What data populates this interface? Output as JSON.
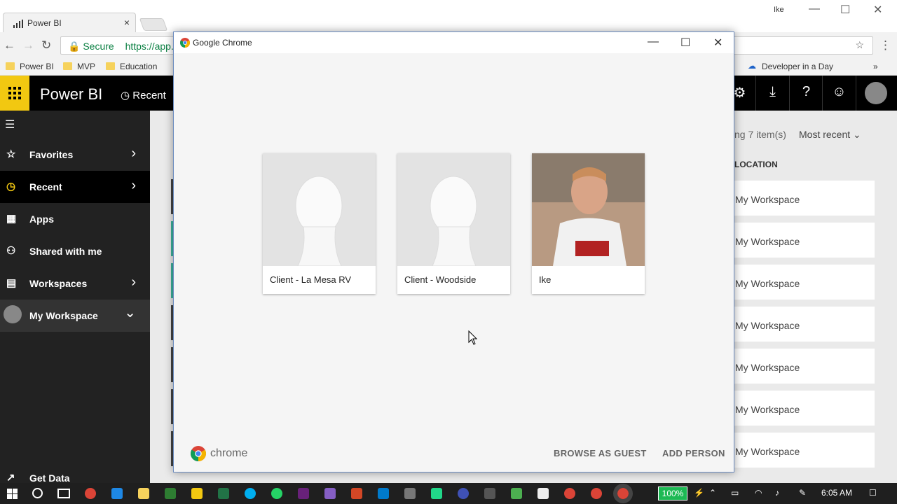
{
  "browser": {
    "tab_title": "Power BI",
    "tab_close": "×",
    "window_user": "Ike",
    "secure_label": "Secure",
    "url": "https://app.p",
    "bookmarks": [
      "Power BI",
      "MVP",
      "Education"
    ],
    "bookmark_right": "Developer in a Day",
    "more": "»"
  },
  "powerbi": {
    "app_name": "Power BI",
    "recent_label": "Recent",
    "nav": [
      {
        "label": "Favorites",
        "arrow": "›"
      },
      {
        "label": "Recent",
        "arrow": "›"
      },
      {
        "label": "Apps",
        "arrow": ""
      },
      {
        "label": "Shared with me",
        "arrow": ""
      },
      {
        "label": "Workspaces",
        "arrow": "›"
      },
      {
        "label": "My Workspace",
        "arrow": "⌄"
      }
    ],
    "get_data": "Get Data",
    "items_count": "ng 7 item(s)",
    "sort": "Most recent",
    "location_header": "LOCATION",
    "locations": [
      "My Workspace",
      "My Workspace",
      "My Workspace",
      "My Workspace",
      "My Workspace",
      "My Workspace",
      "My Workspace"
    ]
  },
  "dialog": {
    "title": "Google Chrome",
    "profiles": [
      {
        "name": "Client - La Mesa RV"
      },
      {
        "name": "Client - Woodside"
      },
      {
        "name": "Ike"
      }
    ],
    "brand": "chrome",
    "browse_guest": "BROWSE AS GUEST",
    "add_person": "ADD PERSON"
  },
  "taskbar": {
    "battery": "100%",
    "time": "6:05 AM"
  },
  "colors": {
    "pbi_yellow": "#f2c811",
    "secure_green": "#0b8043",
    "nav_bg": "#222222"
  }
}
